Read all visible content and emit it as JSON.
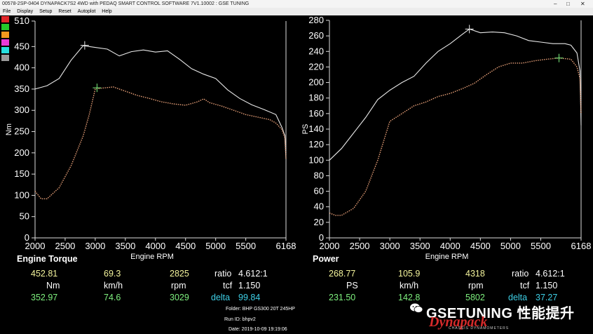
{
  "window": {
    "title": "00578-2SP-0404 DYNAPACK7S2 4WD with PEDAQ SMART CONTROL SOFTWARE 7V1.10002 : GSE TUNING",
    "minimize": "–",
    "maximize": "□",
    "close": "✕"
  },
  "menu": [
    "File",
    "Display",
    "Setup",
    "Reset",
    "Autoplot",
    "Help"
  ],
  "swatches": [
    "#e0262a",
    "#26c82a",
    "#f59a1e",
    "#e83ad8",
    "#26dede",
    "#9a9a9a"
  ],
  "torque_panel": {
    "label": "Engine Torque",
    "xlabel": "Engine RPM",
    "ylabel": "Nm"
  },
  "power_panel": {
    "label": "Power",
    "xlabel": "Engine RPM",
    "ylabel": "PS"
  },
  "chart_data": [
    {
      "type": "line",
      "xlabel": "Engine RPM",
      "ylabel": "Nm",
      "xlim": [
        2000,
        6168
      ],
      "ylim": [
        0,
        510
      ],
      "x_ticks": [
        "2000",
        "2500",
        "3000",
        "3500",
        "4000",
        "4500",
        "5000",
        "5500",
        "6168"
      ],
      "x_tick_values": [
        2000,
        2500,
        3000,
        3500,
        4000,
        4500,
        5000,
        5500,
        6168
      ],
      "y_ticks": [
        0,
        50,
        100,
        150,
        200,
        250,
        300,
        350,
        400,
        450,
        510
      ],
      "series": [
        {
          "color": "#e8e8e8",
          "dashed": false,
          "x": [
            2000,
            2200,
            2400,
            2600,
            2800,
            3000,
            3200,
            3400,
            3600,
            3800,
            4000,
            4200,
            4400,
            4600,
            4800,
            5000,
            5200,
            5400,
            5600,
            5800,
            6000,
            6100,
            6150,
            6168
          ],
          "y": [
            350,
            358,
            375,
            418,
            452,
            448,
            444,
            428,
            438,
            442,
            437,
            440,
            420,
            398,
            385,
            375,
            348,
            328,
            313,
            302,
            290,
            260,
            240,
            185
          ]
        },
        {
          "color": "#e8a078",
          "dashed": true,
          "x": [
            2000,
            2100,
            2200,
            2400,
            2600,
            2800,
            2900,
            3000,
            3100,
            3300,
            3500,
            3700,
            3900,
            4100,
            4300,
            4500,
            4700,
            4800,
            4900,
            5100,
            5300,
            5500,
            5700,
            5900,
            6000,
            6100,
            6150,
            6168
          ],
          "y": [
            110,
            92,
            92,
            118,
            170,
            240,
            290,
            350,
            352,
            355,
            345,
            335,
            328,
            320,
            315,
            312,
            320,
            327,
            318,
            310,
            300,
            290,
            284,
            278,
            270,
            255,
            235,
            185
          ]
        }
      ],
      "markers": [
        {
          "x": 2825,
          "y": 452.81,
          "color": "#e8e8e8"
        },
        {
          "x": 3029,
          "y": 352.97,
          "color": "#7ef07e"
        }
      ]
    },
    {
      "type": "line",
      "xlabel": "Engine RPM",
      "ylabel": "PS",
      "xlim": [
        2000,
        6168
      ],
      "ylim": [
        0,
        280
      ],
      "x_ticks": [
        "2000",
        "2500",
        "3000",
        "3500",
        "4000",
        "4500",
        "5000",
        "5500",
        "6168"
      ],
      "x_tick_values": [
        2000,
        2500,
        3000,
        3500,
        4000,
        4500,
        5000,
        5500,
        6168
      ],
      "y_ticks": [
        0,
        20,
        40,
        60,
        80,
        100,
        120,
        140,
        160,
        180,
        200,
        220,
        240,
        260,
        280
      ],
      "series": [
        {
          "color": "#e8e8e8",
          "dashed": false,
          "x": [
            2000,
            2200,
            2400,
            2600,
            2800,
            3000,
            3200,
            3400,
            3600,
            3800,
            4000,
            4200,
            4318,
            4500,
            4700,
            4900,
            5100,
            5300,
            5500,
            5700,
            5900,
            6000,
            6100,
            6150,
            6168
          ],
          "y": [
            100,
            115,
            135,
            155,
            178,
            190,
            200,
            208,
            225,
            240,
            250,
            262,
            268.77,
            264,
            265,
            264,
            260,
            254,
            252,
            250,
            250,
            248,
            238,
            215,
            145
          ]
        },
        {
          "color": "#e8a078",
          "dashed": true,
          "x": [
            2000,
            2100,
            2200,
            2400,
            2600,
            2800,
            3000,
            3200,
            3400,
            3600,
            3800,
            4000,
            4200,
            4400,
            4600,
            4800,
            5000,
            5200,
            5400,
            5600,
            5802,
            6000,
            6100,
            6150,
            6168
          ],
          "y": [
            32,
            29,
            29,
            38,
            60,
            100,
            150,
            160,
            170,
            175,
            182,
            186,
            192,
            199,
            210,
            220,
            225,
            225,
            228,
            230,
            231.5,
            230,
            220,
            205,
            160
          ]
        }
      ],
      "markers": [
        {
          "x": 4318,
          "y": 268.77,
          "color": "#e8e8e8"
        },
        {
          "x": 5802,
          "y": 231.5,
          "color": "#7ef07e"
        }
      ]
    }
  ],
  "readout": {
    "torque": {
      "val1": "452.81",
      "val2": "69.3",
      "val3": "2825",
      "unit1": "Nm",
      "unit2": "km/h",
      "unit3": "rpm",
      "val4": "352.97",
      "val5": "74.6",
      "val6": "3029",
      "ratio_label": "ratio",
      "ratio": "4.612:1",
      "tcf_label": "tcf",
      "tcf": "1.150",
      "delta_label": "delta",
      "delta": "99.84"
    },
    "power": {
      "val1": "268.77",
      "val2": "105.9",
      "val3": "4318",
      "unit1": "PS",
      "unit2": "km/h",
      "unit3": "rpm",
      "val4": "231.50",
      "val5": "142.8",
      "val6": "5802",
      "ratio_label": "ratio",
      "ratio": "4.612:1",
      "tcf_label": "tcf",
      "tcf": "1.150",
      "delta_label": "delta",
      "delta": "37.27"
    }
  },
  "info": {
    "folder": "Folder:  BHP GS300 20T 245HP",
    "run_id": "Run ID:  bhpv2",
    "date": "Date:  2019-10-09 19:19:06"
  },
  "watermark": "GSETUNING 性能提升",
  "logo": "Dynapack",
  "logo_sub": "CHASSIS DYNAMOMETERS"
}
